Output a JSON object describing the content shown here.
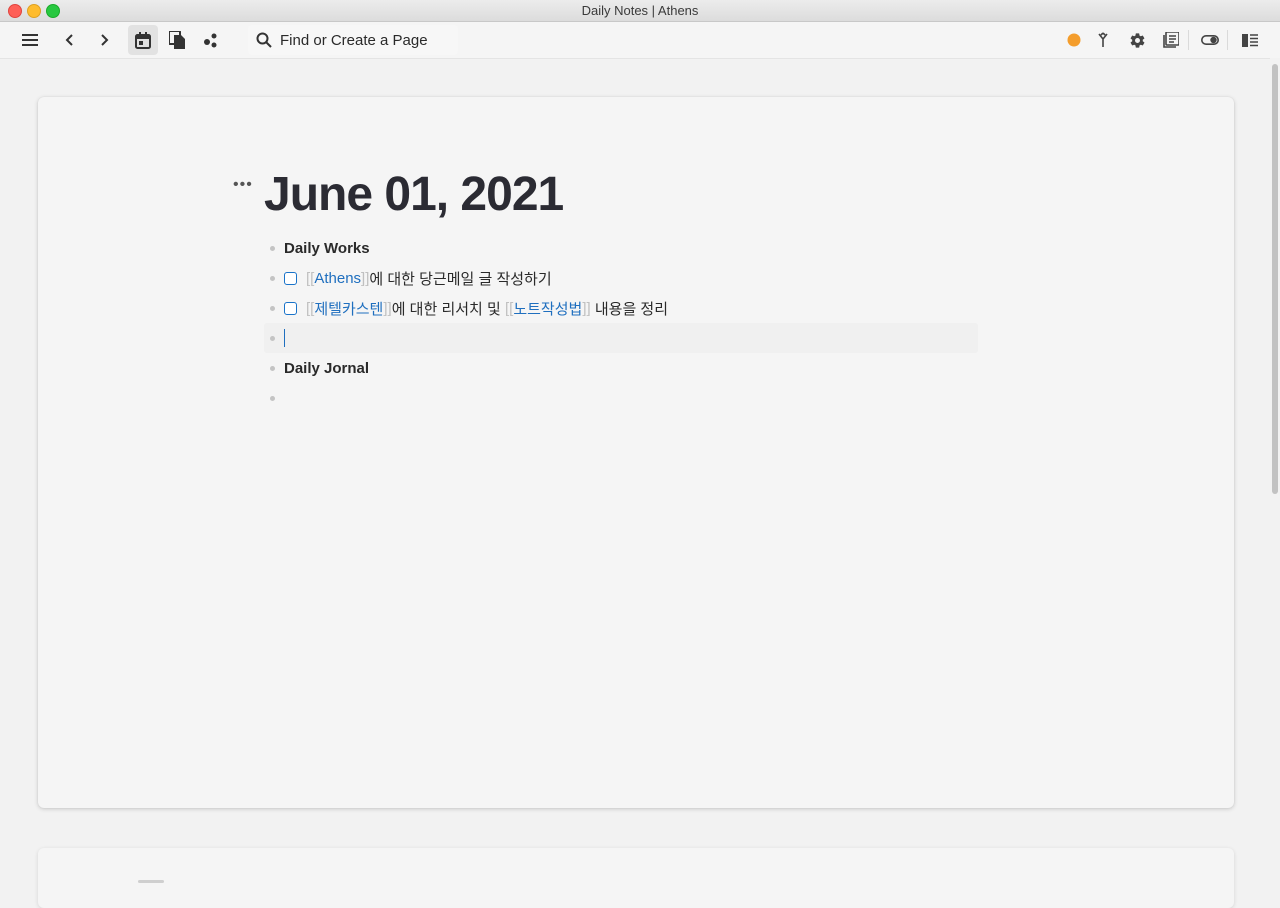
{
  "window": {
    "title": "Daily Notes | Athens"
  },
  "toolbar": {
    "search_placeholder": "Find or Create a Page",
    "icons": [
      "menu-icon",
      "back-icon",
      "forward-icon",
      "calendar-icon",
      "pages-icon",
      "graph-icon",
      "sync-status-icon",
      "merge-icon",
      "settings-icon",
      "database-icon",
      "theme-toggle-icon",
      "right-sidebar-icon"
    ],
    "status_color": "#f49d2c"
  },
  "page": {
    "title": "June 01, 2021",
    "blocks": [
      {
        "type": "text",
        "bold": true,
        "text": "Daily Works"
      },
      {
        "type": "todo",
        "link": "Athens",
        "bracket_open": "[[",
        "bracket_close": "]]",
        "rest": "에 대한 당근메일 글 작성하기"
      },
      {
        "type": "todo",
        "link": "제텔카스텐",
        "bracket_open": "[[",
        "bracket_close": "]]",
        "middle": "에 대한 리서치 및 ",
        "link2": "노트작성법",
        "rest": " 내용을 정리"
      },
      {
        "type": "editing",
        "text": ""
      },
      {
        "type": "text",
        "bold": true,
        "text": "Daily Jornal"
      },
      {
        "type": "empty",
        "text": ""
      }
    ]
  },
  "colors": {
    "link": "#1f6fbf",
    "accent": "#1a73c9"
  }
}
